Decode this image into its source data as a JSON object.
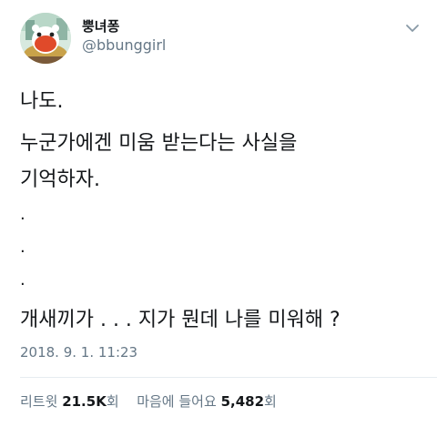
{
  "user": {
    "display_name": "뿡녀퐁",
    "handle": "@bbunggirl"
  },
  "icons": {
    "avatar": "profile-avatar",
    "more": "chevron-down-icon"
  },
  "tweet": {
    "line1": "나도.",
    "line2": "누군가에겐 미움 받는다는 사실을",
    "line3": "기억하자.",
    "dot1": ".",
    "dot2": ".",
    "dot3": ".",
    "line4": "개새끼가 . . . 지가 뭔데 나를 미워해 ?",
    "timestamp": "2018. 9. 1. 11:23"
  },
  "stats": {
    "retweets_label": "리트윗",
    "retweets_count": "21.5K",
    "retweets_unit": "회",
    "likes_label": "마음에 들어요",
    "likes_count": "5,482",
    "likes_unit": "회"
  },
  "colors": {
    "text": "#14171a",
    "secondary": "#657786",
    "divider": "#e6ecf0"
  }
}
